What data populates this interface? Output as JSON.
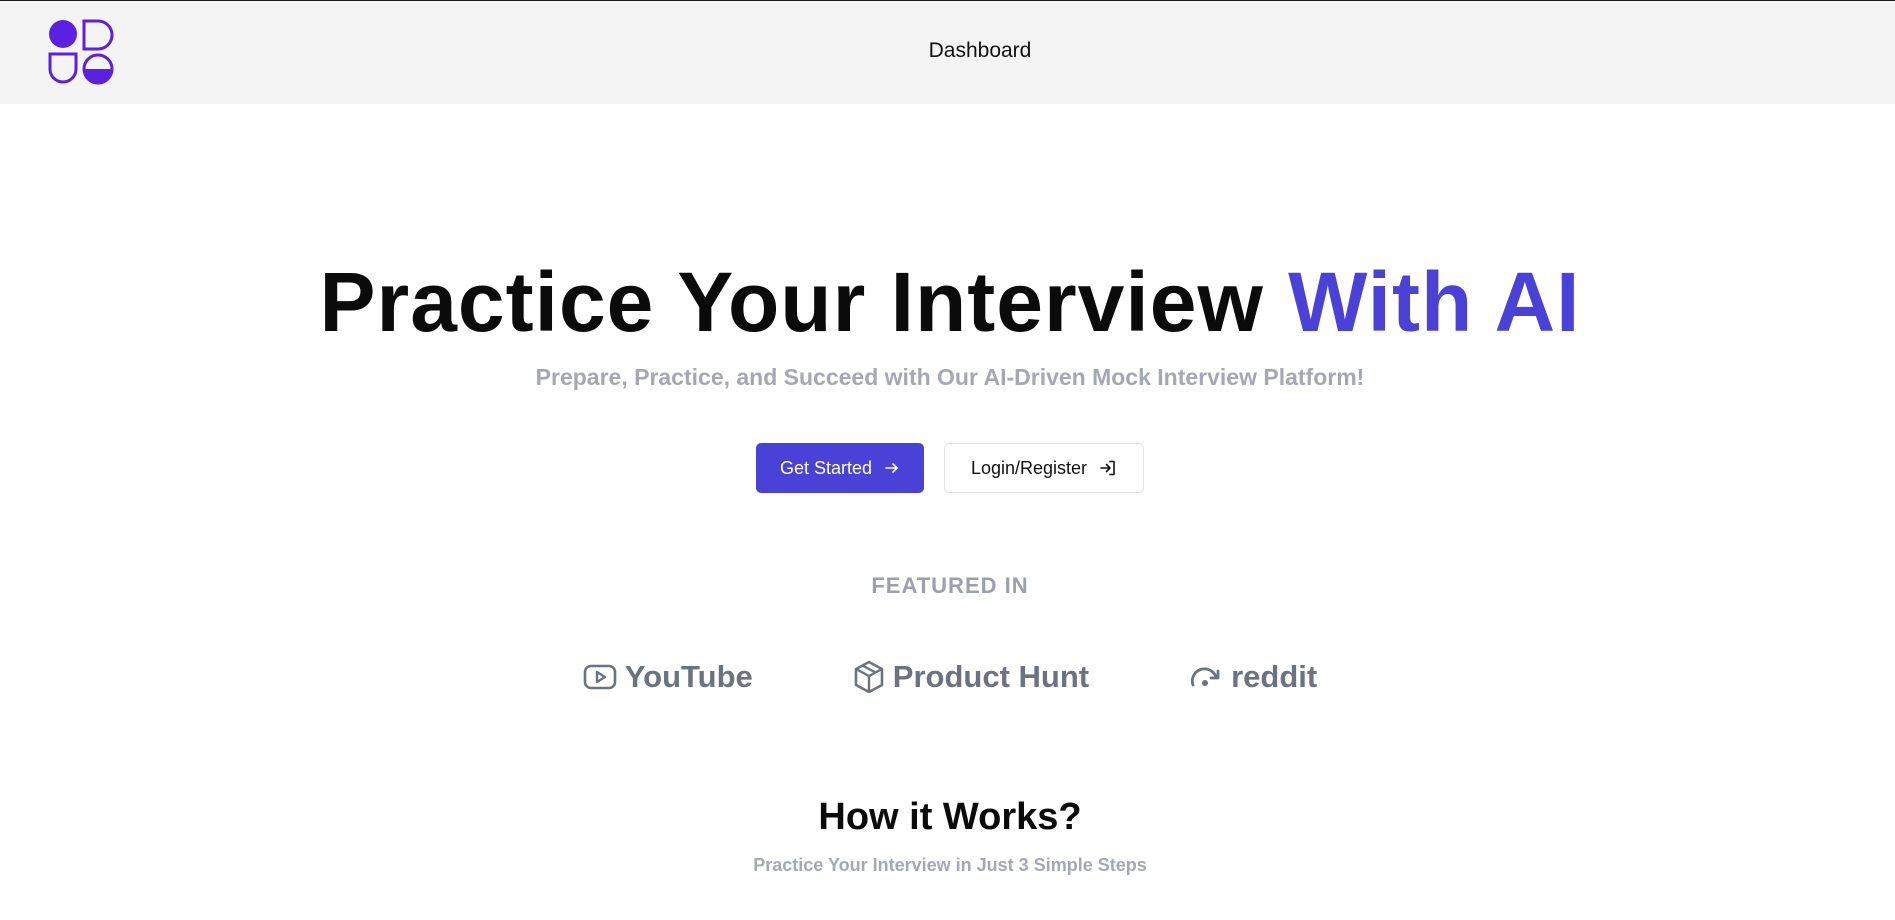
{
  "header": {
    "nav_dashboard": "Dashboard",
    "logo_icon": "app-logo-icon"
  },
  "hero": {
    "title_main": "Practice Your Interview ",
    "title_accent": "With AI",
    "subtitle": "Prepare, Practice, and Succeed with Our AI-Driven Mock Interview Platform!",
    "cta_primary": "Get Started",
    "cta_secondary": "Login/Register"
  },
  "featured": {
    "heading": "FEATURED IN",
    "brands": [
      {
        "label": "YouTube",
        "icon": "youtube-icon"
      },
      {
        "label": "Product Hunt",
        "icon": "package-icon"
      },
      {
        "label": "reddit",
        "icon": "reddit-icon"
      }
    ]
  },
  "how_it_works": {
    "title": "How it Works?",
    "subtitle": "Practice Your Interview in Just 3 Simple Steps"
  },
  "colors": {
    "accent": "#4a42d6",
    "logo": "#5b21e0",
    "muted": "#a3a8b4",
    "brand_gray": "#6b7280",
    "header_bg": "#f4f4f4"
  }
}
